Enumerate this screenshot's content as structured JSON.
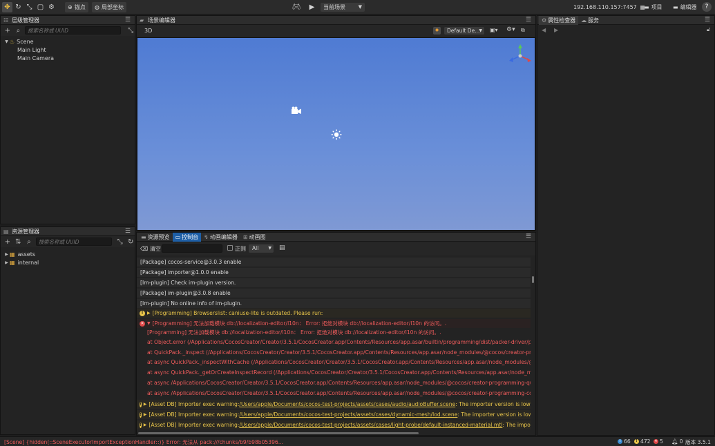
{
  "toolbar": {
    "pivot_label": "锚点",
    "local_label": "局部坐标",
    "scene_select": "当前场景",
    "ip": "192.168.110.157:7457",
    "project_label": "项目",
    "editor_label": "编辑器",
    "help": "?"
  },
  "hierarchy": {
    "title": "层级管理器",
    "search_placeholder": "搜索名称或 UUID",
    "root": "Scene",
    "children": [
      "Main Light",
      "Main Camera"
    ]
  },
  "assets": {
    "title": "资源管理器",
    "search_placeholder": "搜索名称或 UUID",
    "items": [
      "assets",
      "internal"
    ]
  },
  "scene_editor": {
    "title": "场景编辑器",
    "mode": "3D",
    "camera_select": "Default De..."
  },
  "inspector": {
    "tab_inspector": "属性检查器",
    "tab_service": "服务"
  },
  "bottom_tabs": {
    "preview": "资源预览",
    "console": "控制台",
    "anim_editor": "动画编辑器",
    "anim_graph": "动画图"
  },
  "console": {
    "clear_label": "清空",
    "regex_label": "正则",
    "filter_value": "All",
    "lines": [
      {
        "type": "normal",
        "text": "[Package] cocos-service@3.0.3 enable"
      },
      {
        "type": "normal",
        "text": "[Package] importer@1.0.0 enable"
      },
      {
        "type": "normal",
        "text": "[Im-plugin] Check im-plugin version."
      },
      {
        "type": "normal",
        "text": "[Package] im-plugin@3.0.8 enable"
      },
      {
        "type": "normal",
        "text": "[Im-plugin] No online info of im-plugin."
      },
      {
        "type": "warn",
        "text": "[Programming] Browserslist: caniuse-lite is outdated. Please run:"
      },
      {
        "type": "error",
        "text": "[Programming] 无法加载模块 db://localization-editor/l10n：  Error: 拒绝对模块 db://localization-editor/l10n 的访问。."
      },
      {
        "type": "error-sub",
        "text": "[Programming] 无法加载模块 db://localization-editor/l10n：  Error: 拒绝对模块 db://localization-editor/l10n 的访问。."
      },
      {
        "type": "error-stack",
        "text": "at Object.error (/Applications/CocosCreator/Creator/3.5.1/CocosCreator.app/Contents/Resources/app.asar/builtin/programming/dist/packer-driver/packer-driver."
      },
      {
        "type": "error-stack",
        "text": "at QuickPack._inspect (/Applications/CocosCreator/Creator/3.5.1/CocosCreator.app/Contents/Resources/app.asar/node_modules/@cocos/creator-programming"
      },
      {
        "type": "error-stack",
        "text": "at async QuickPack._inspectWithCache (/Applications/CocosCreator/Creator/3.5.1/CocosCreator.app/Contents/Resources/app.asar/node_modules/@cocos/crea"
      },
      {
        "type": "error-stack",
        "text": "at async QuickPack._getOrCreateInspectRecord (/Applications/CocosCreator/Creator/3.5.1/CocosCreator.app/Contents/Resources/app.asar/node_modules/@coc"
      },
      {
        "type": "error-stack",
        "text": "at async /Applications/CocosCreator/Creator/3.5.1/CocosCreator.app/Contents/Resources/app.asar/node_modules/@cocos/creator-programming-quick-pack/lib"
      },
      {
        "type": "error-stack",
        "text": "at async /Applications/CocosCreator/Creator/3.5.1/CocosCreator.app/Contents/Resources/app.asar/node_modules/@cocos/creator-programming-common/lib/ta"
      }
    ],
    "asset_warnings": [
      {
        "prefix": "[Asset DB] Importer exec warning: ",
        "path": "/Users/apple/Documents/cocos-test-projects/assets/cases/audio/audioBuffer.scene",
        "suffix": ": The importer version is lower than ass"
      },
      {
        "prefix": "[Asset DB] Importer exec warning: ",
        "path": "/Users/apple/Documents/cocos-test-projects/assets/cases/dynamic-mesh/lod.scene",
        "suffix": ": The importer version is lower than as"
      },
      {
        "prefix": "[Asset DB] Importer exec warning: ",
        "path": "/Users/apple/Documents/cocos-test-projects/assets/cases/light-probe/default-instanced-material.mtl",
        "suffix": ": The importer versio"
      }
    ]
  },
  "statusbar": {
    "message": "[Scene] {hidden(::SceneExecutorImportExceptionHandler::)} Error: 无法从 pack:///chunks/b9/b98b05396...",
    "info_count": "66",
    "warn_count": "472",
    "error_count": "5",
    "notify_count": "0",
    "version": "版本 3.5.1"
  },
  "colors": {
    "accent": "#1e5fa6",
    "warn": "#e8c44a",
    "error": "#ef5b5b",
    "scene_sky": "#5f87d6"
  }
}
